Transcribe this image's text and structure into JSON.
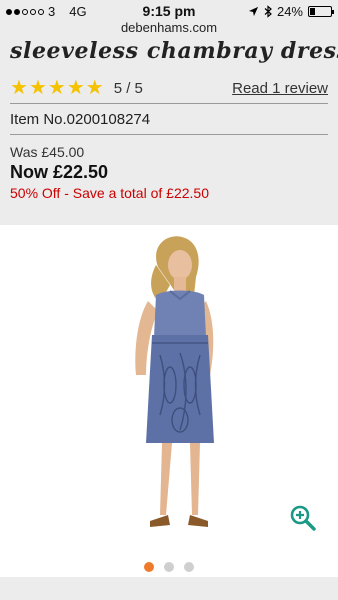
{
  "status": {
    "carrier": "3",
    "network": "4G",
    "time": "9:15 pm",
    "battery": "24%",
    "battery_level": 0.24
  },
  "browser": {
    "url": "debenhams.com"
  },
  "product": {
    "title": "sleeveless chambray dress",
    "rating_text": "5 / 5",
    "rating_value": 5,
    "review_link": "Read 1 review",
    "item_no": "Item No.0200108274",
    "was_price": "Was £45.00",
    "now_price": "Now £22.50",
    "saving": "50% Off - Save a total of  £22.50"
  },
  "gallery": {
    "image_count": 3,
    "active_index": 0
  },
  "colors": {
    "accent": "#ee7a2c",
    "sale_red": "#cc0000",
    "star": "#f5c200",
    "zoom": "#1a9a86"
  }
}
